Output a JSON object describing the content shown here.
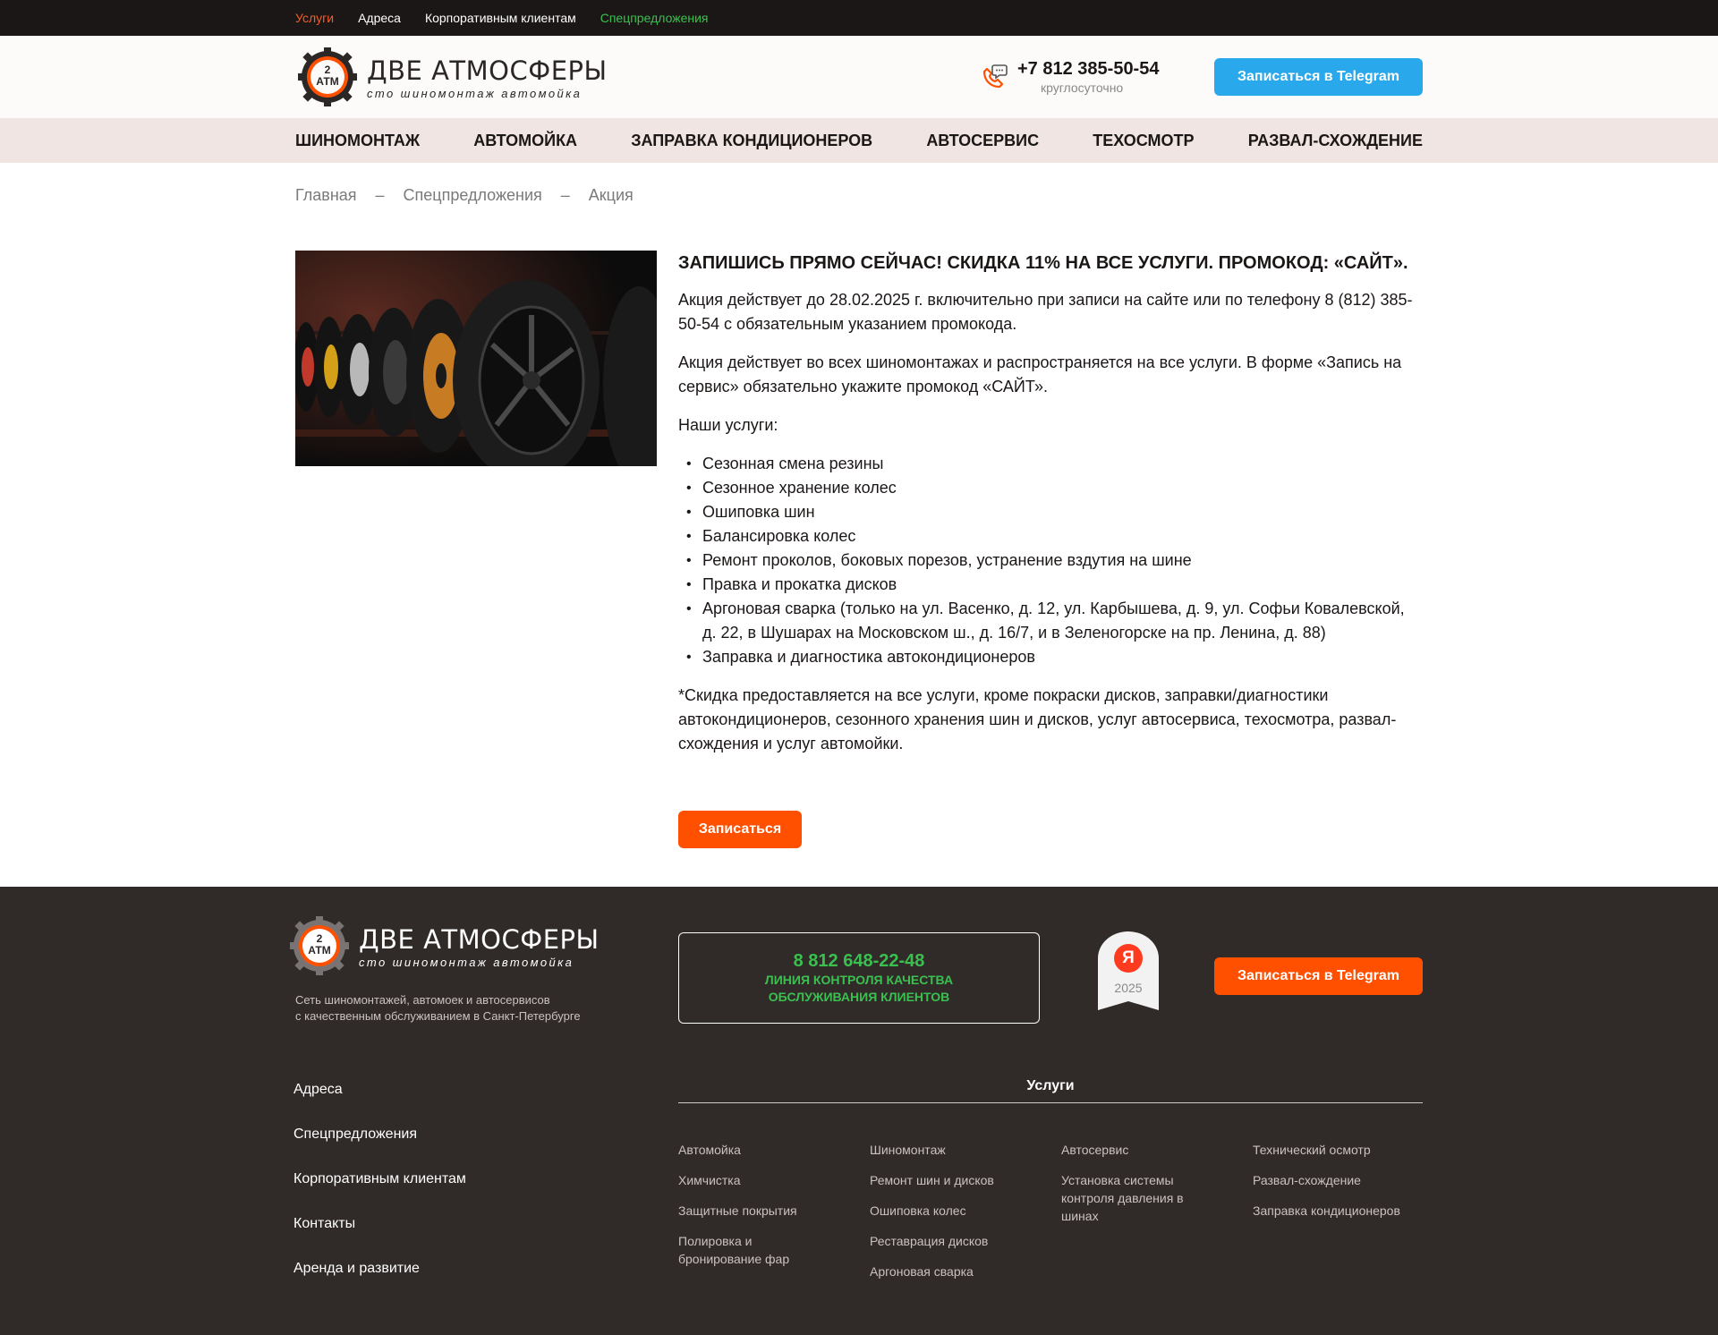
{
  "topbar": {
    "links": [
      "Услуги",
      "Адреса",
      "Корпоративным клиентам",
      "Спецпредложения"
    ]
  },
  "header": {
    "logo_badge": "2 АТМ",
    "logo_title": "ДВЕ АТМОСФЕРЫ",
    "logo_subtitle": "сто шиномонтаж автомойка",
    "phone": "+7 812 385-50-54",
    "phone_note": "круглосуточно",
    "telegram_button": "Записаться в Telegram"
  },
  "nav": {
    "items": [
      "Шиномонтаж",
      "Автомойка",
      "Заправка кондиционеров",
      "Автосервис",
      "Техосмотр",
      "Развал-схождение"
    ]
  },
  "breadcrumb": {
    "items": [
      "Главная",
      "Спецпредложения",
      "Акция"
    ],
    "separator": "–"
  },
  "promo": {
    "title": "Запишись прямо сейчас! Скидка 11% на все услуги. Промокод: «САЙТ».",
    "p1": "Акция действует до 28.02.2025 г. включительно при записи на сайте или по телефону 8 (812) 385-50-54 с обязательным указанием промокода.",
    "p2": "Акция действует во всех шиномонтажах и распространяется на все услуги. В форме «Запись на сервис» обязательно укажите промокод «САЙТ».",
    "p3": "Наши услуги:",
    "services": [
      "Сезонная смена резины",
      "Сезонное хранение колес",
      "Ошиповка шин",
      "Балансировка колес",
      "Ремонт проколов, боковых порезов, устранение вздутия на шине",
      "Правка  и прокатка дисков",
      "Аргоновая сварка (только на ул. Васенко, д. 12, ул. Карбышева, д. 9, ул. Софьи Ковалевской, д. 22, в Шушарах на Московском ш., д. 16/7, и в Зеленогорске на пр. Ленина, д. 88)",
      "Заправка и диагностика автокондиционеров"
    ],
    "note": "*Скидка предоставляется на все услуги, кроме покраски дисков, заправки/диагностики автокондиционеров, сезонного хранения шин и дисков, услуг автосервиса, техосмотра, развал-схождения и услуг автомойки.",
    "signup_button": "Записаться"
  },
  "footer": {
    "logo_badge": "2 АТМ",
    "logo_title": "ДВЕ АТМОСФЕРЫ",
    "logo_subtitle": "сто шиномонтаж автомойка",
    "description_line1": "Сеть шиномонтажей, автомоек и автосервисов",
    "description_line2": "с качественным обслуживанием в Санкт-Петербурге",
    "quality_phone": "8 812 648-22-48",
    "quality_line1": "Линия контроля качества",
    "quality_line2": "обслуживания клиентов",
    "yandex_letter": "Я",
    "yandex_year": "2025",
    "telegram_button": "Записаться в Telegram",
    "links": [
      "Адреса",
      "Спецпредложения",
      "Корпоративным клиентам",
      "Контакты",
      "Аренда и развитие"
    ],
    "services_title": "Услуги",
    "services_cols": [
      [
        "Автомойка",
        "Химчистка",
        "Защитные покрытия",
        "Полировка и бронирование фар"
      ],
      [
        "Шиномонтаж",
        "Ремонт шин и дисков",
        "Ошиповка колес",
        "Реставрация дисков",
        "Аргоновая сварка"
      ],
      [
        "Автосервис",
        "Установка системы контроля давления в шинах"
      ],
      [
        "Технический осмотр",
        "Развал-схождение",
        "Заправка кондиционеров"
      ]
    ]
  },
  "colors": {
    "accent_orange": "#ff5000",
    "telegram_blue": "#29a9eb",
    "green": "#3ac04f",
    "footer_bg": "#302a29",
    "topbar_bg": "#1b1716",
    "nav_bg": "#f1e5e3"
  }
}
